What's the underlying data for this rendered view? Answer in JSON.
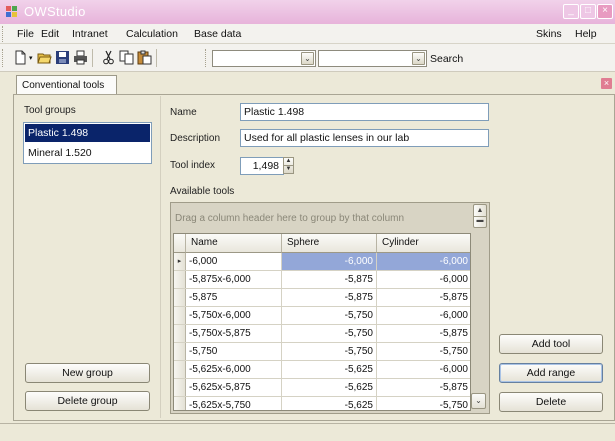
{
  "window": {
    "title": "OWStudio",
    "minimize": "_",
    "maximize": "□",
    "close": "×"
  },
  "menu": {
    "file": "File",
    "edit": "Edit",
    "intranet": "Intranet",
    "calculation": "Calculation",
    "base_data": "Base data",
    "skins": "Skins",
    "help": "Help"
  },
  "toolbar": {
    "icons": [
      "new-document-icon",
      "open-folder-icon",
      "save-icon",
      "print-icon",
      "cut-icon",
      "copy-icon",
      "paste-icon"
    ],
    "combo1_value": "",
    "combo2_value": "",
    "search_label": "Search"
  },
  "tabs": [
    {
      "label": "Conventional tools",
      "active": true
    }
  ],
  "tool_groups": {
    "label": "Tool groups",
    "items": [
      {
        "label": "Plastic 1.498",
        "selected": true
      },
      {
        "label": "Mineral 1.520",
        "selected": false
      }
    ],
    "new_group": "New group",
    "delete_group": "Delete group"
  },
  "form": {
    "name_label": "Name",
    "name_value": "Plastic 1.498",
    "description_label": "Description",
    "description_value": "Used for all plastic lenses in our lab",
    "tool_index_label": "Tool index",
    "tool_index_value": "1,498",
    "available_tools_label": "Available tools"
  },
  "grid": {
    "group_hint": "Drag a column header here to group by that column",
    "columns": [
      "Name",
      "Sphere",
      "Cylinder"
    ],
    "rows": [
      [
        "-6,000",
        "-6,000",
        "-6,000"
      ],
      [
        "-5,875x-6,000",
        "-5,875",
        "-6,000"
      ],
      [
        "-5,875",
        "-5,875",
        "-5,875"
      ],
      [
        "-5,750x-6,000",
        "-5,750",
        "-6,000"
      ],
      [
        "-5,750x-5,875",
        "-5,750",
        "-5,875"
      ],
      [
        "-5,750",
        "-5,750",
        "-5,750"
      ],
      [
        "-5,625x-6,000",
        "-5,625",
        "-6,000"
      ],
      [
        "-5,625x-5,875",
        "-5,625",
        "-5,875"
      ],
      [
        "-5,625x-5,750",
        "-5,625",
        "-5,750"
      ]
    ],
    "selected_row": 0
  },
  "actions": {
    "add_tool": "Add tool",
    "add_range": "Add range",
    "delete": "Delete"
  },
  "colors": {
    "title_bar": "#e7b3da",
    "selection": "#0a246a",
    "grid_selection": "#93a7d8"
  }
}
